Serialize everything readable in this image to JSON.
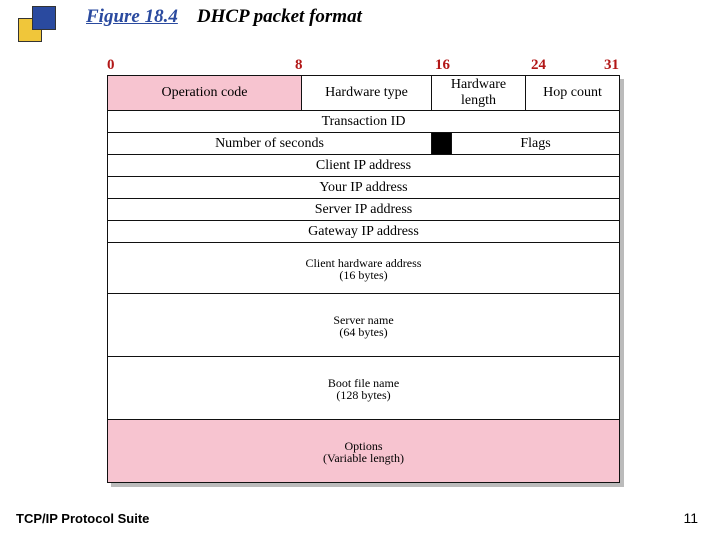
{
  "title": {
    "figure": "Figure 18.4",
    "caption": "DHCP packet format"
  },
  "bit_labels": {
    "b0": "0",
    "b8": "8",
    "b16": "16",
    "b24": "24",
    "b31": "31"
  },
  "rows": {
    "r1": {
      "opcode": "Operation code",
      "hwtype": "Hardware type",
      "hwlen": "Hardware length",
      "hop": "Hop count"
    },
    "r2": {
      "txid": "Transaction ID"
    },
    "r3": {
      "secs": "Number of seconds",
      "flagbar": "",
      "flags": "Flags"
    },
    "r4": {
      "ciaddr": "Client IP address"
    },
    "r5": {
      "yiaddr": "Your IP address"
    },
    "r6": {
      "siaddr": "Server IP address"
    },
    "r7": {
      "giaddr": "Gateway IP address"
    },
    "r8": {
      "chaddr_line1": "Client hardware address",
      "chaddr_line2": "(16 bytes)"
    },
    "r9": {
      "sname_line1": "Server name",
      "sname_line2": "(64 bytes)"
    },
    "r10": {
      "bootf_line1": "Boot file name",
      "bootf_line2": "(128 bytes)"
    },
    "r11": {
      "opt_line1": "Options",
      "opt_line2": "(Variable length)"
    }
  },
  "footer": "TCP/IP Protocol Suite",
  "page": "11"
}
